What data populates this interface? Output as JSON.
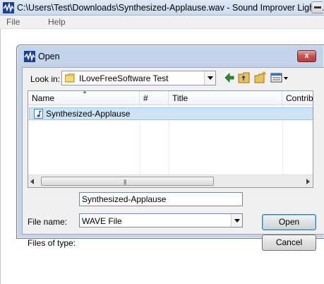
{
  "window": {
    "title": "C:\\Users\\Test\\Downloads\\Synthesized-Applause.wav - Sound Improver Light ...",
    "menu": [
      "File",
      "Help"
    ]
  },
  "dialog": {
    "title": "Open",
    "close_label": "x",
    "look_in": {
      "label": "Look in:",
      "value": "ILoveFreeSoftware Test"
    },
    "toolbar_icons": [
      "back-arrow-icon",
      "up-folder-icon",
      "new-folder-icon",
      "view-menu-icon"
    ],
    "columns": [
      "Name",
      "#",
      "Title",
      "Contribu"
    ],
    "files": [
      {
        "name": "Synthesized-Applause",
        "icon": "audio-file-icon"
      }
    ],
    "file_name": {
      "label": "File name:",
      "value": "Synthesized-Applause"
    },
    "file_type": {
      "label": "Files of type:",
      "value": "WAVE File"
    },
    "buttons": {
      "open": "Open",
      "cancel": "Cancel"
    },
    "scroll_grip": "|||"
  },
  "colors": {
    "selection": "#cde4f7",
    "dialog_frame": "#c3d4ea",
    "close_button": "#c75050"
  }
}
